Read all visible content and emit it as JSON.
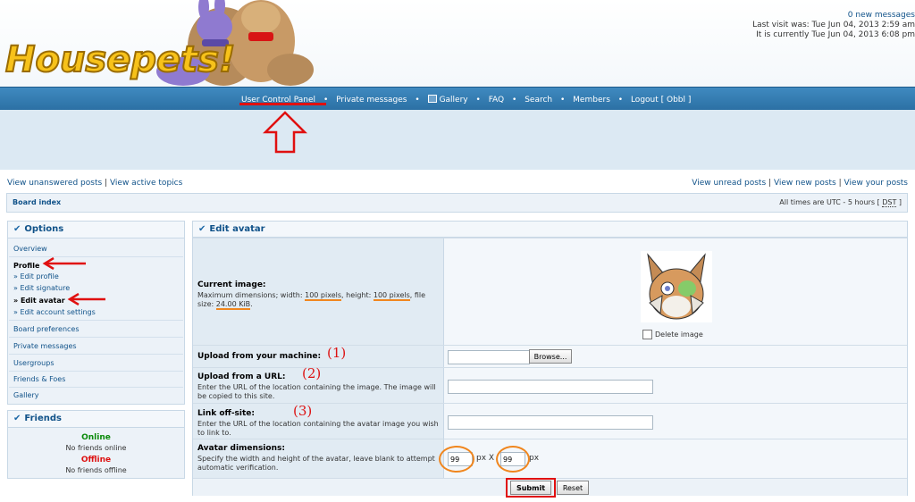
{
  "header": {
    "logo_text": "Housepets!",
    "new_messages_count": "0",
    "new_messages_label": "new messages",
    "last_visit": "Last visit was: Tue Jun 04, 2013 2:59 am",
    "currently": "It is currently Tue Jun 04, 2013 6:08 pm"
  },
  "nav": {
    "ucp": "User Control Panel",
    "pm": "Private messages",
    "gallery": "Gallery",
    "faq": "FAQ",
    "search": "Search",
    "members": "Members",
    "logout": "Logout [ Obbl ]",
    "sep": "•"
  },
  "links": {
    "unanswered": "View unanswered posts",
    "active": "View active topics",
    "unread": "View unread posts",
    "new_posts": "View new posts",
    "your_posts": "View your posts",
    "pipe": "|"
  },
  "breadcrumb": {
    "board_index": "Board index",
    "times_prefix": "All times are UTC - 5 hours [",
    "dst": "DST",
    "times_suffix": "]"
  },
  "options": {
    "title": "Options",
    "overview": "Overview",
    "profile": "Profile",
    "edit_profile": "» Edit profile",
    "edit_signature": "» Edit signature",
    "edit_avatar": "» Edit avatar",
    "edit_account": "» Edit account settings",
    "board_prefs": "Board preferences",
    "private_messages": "Private messages",
    "usergroups": "Usergroups",
    "friends_foes": "Friends & Foes",
    "gallery": "Gallery"
  },
  "friends": {
    "title": "Friends",
    "online": "Online",
    "no_online": "No friends online",
    "offline": "Offline",
    "no_offline": "No friends offline"
  },
  "avatar": {
    "title": "Edit avatar",
    "current_label": "Current image:",
    "max_prefix": "Maximum dimensions; width: ",
    "width_val": "100 pixels",
    "height_prefix": ", height: ",
    "height_val": "100 pixels",
    "filesize_prefix": ", file size: ",
    "filesize_val": "24.00 KiB",
    "filesize_suffix": ".",
    "delete_label": "Delete image",
    "upload_machine_label": "Upload from your machine:",
    "browse_label": "Browse...",
    "upload_url_label": "Upload from a URL:",
    "upload_url_desc": "Enter the URL of the location containing the image. The image will be copied to this site.",
    "link_offsite_label": "Link off-site:",
    "link_offsite_desc": "Enter the URL of the location containing the avatar image you wish to link to.",
    "dimensions_label": "Avatar dimensions:",
    "dimensions_desc": "Specify the width and height of the avatar, leave blank to attempt automatic verification.",
    "width_value": "99",
    "height_value": "99",
    "px_x": "px X",
    "px": "px",
    "submit": "Submit",
    "reset": "Reset"
  },
  "annotations": {
    "n1": "(1)",
    "n2": "(2)",
    "n3": "(3)"
  },
  "colors": {
    "nav_blue": "#2b6fa3",
    "link_blue": "#105289",
    "annotation_red": "#e01010",
    "annotation_orange": "#f0861e"
  }
}
